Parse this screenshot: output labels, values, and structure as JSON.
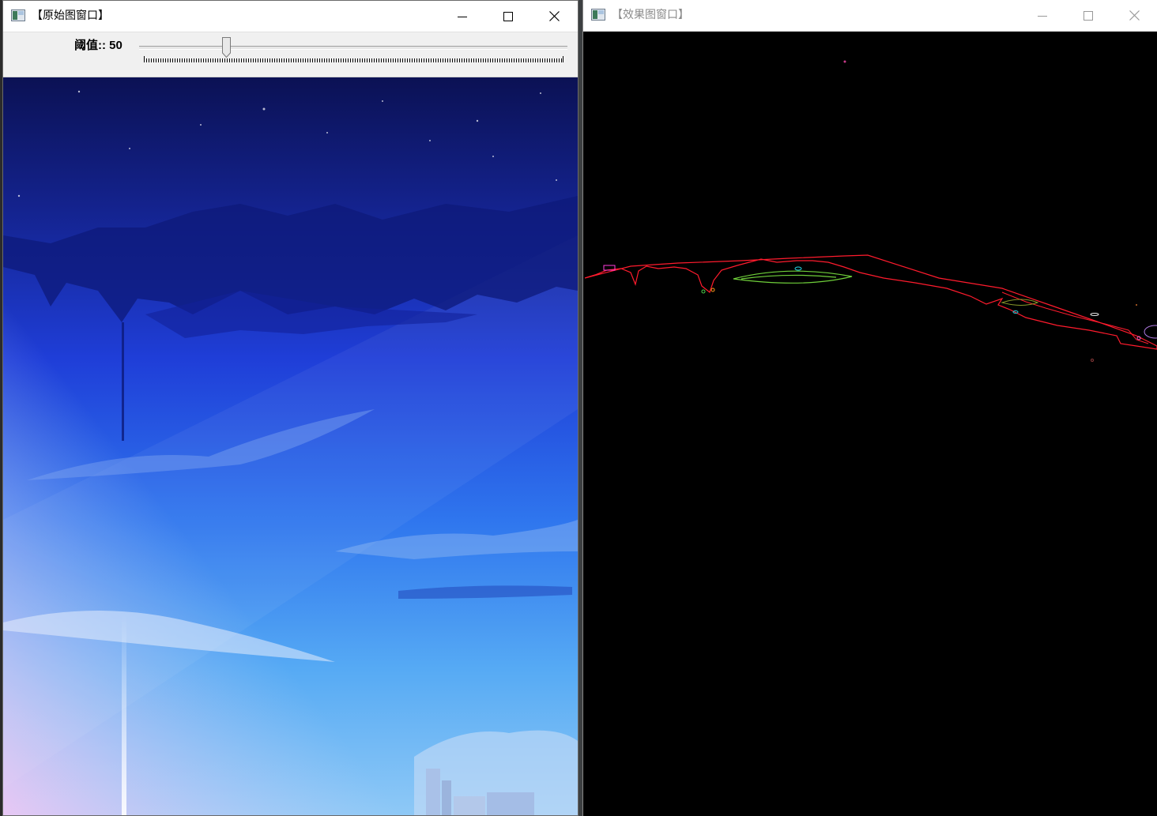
{
  "windows": {
    "original": {
      "title": "【原始图窗口】",
      "trackbar": {
        "label": "阈值:: 50",
        "value": 50,
        "max": 255
      }
    },
    "result": {
      "title": "【效果图窗口】"
    }
  },
  "controls": {
    "minimize_icon": "minimize-icon",
    "maximize_icon": "maximize-icon",
    "close_icon": "close-icon"
  },
  "colors": {
    "sky_top": "#0b1154",
    "sky_mid": "#1e3be0",
    "sky_bottom": "#7fc4f4",
    "contour_main": "#ff1b2d",
    "contour_green": "#6fcf3a",
    "contour_magenta": "#ff3cdc",
    "result_bg": "#000000"
  }
}
